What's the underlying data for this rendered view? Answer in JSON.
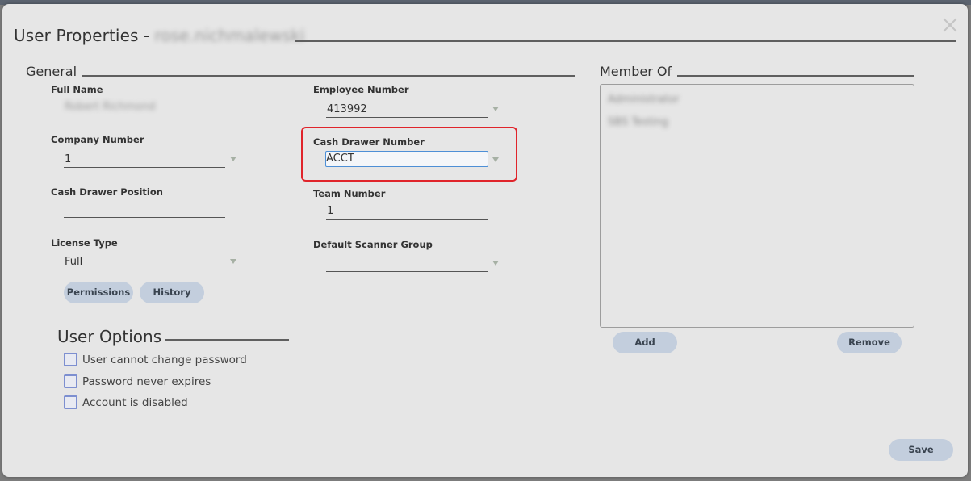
{
  "dialog": {
    "title": "User Properties -",
    "username": "rose.nichmalewski",
    "close_glyph": "×"
  },
  "general": {
    "title": "General",
    "full_name": {
      "label": "Full Name",
      "value": "Robert Richmond"
    },
    "company_number": {
      "label": "Company Number",
      "value": "1"
    },
    "cash_drawer_position": {
      "label": "Cash Drawer Position",
      "value": ""
    },
    "license_type": {
      "label": "License Type",
      "value": "Full"
    },
    "employee_number": {
      "label": "Employee Number",
      "value": "413992"
    },
    "cash_drawer_number": {
      "label": "Cash Drawer Number",
      "value": "ACCT"
    },
    "team_number": {
      "label": "Team Number",
      "value": "1"
    },
    "default_scanner_group": {
      "label": "Default Scanner Group",
      "value": ""
    },
    "permissions_button": "Permissions",
    "history_button": "History"
  },
  "user_options": {
    "title": "User Options",
    "options": [
      {
        "label": "User cannot change password",
        "checked": false
      },
      {
        "label": "Password never expires",
        "checked": false
      },
      {
        "label": "Account is disabled",
        "checked": false
      }
    ]
  },
  "member_of": {
    "title": "Member Of",
    "items": [
      "Administrator",
      "SBS Testing"
    ],
    "add_button": "Add",
    "remove_button": "Remove"
  },
  "footer": {
    "save_button": "Save"
  },
  "colors": {
    "highlight": "#e0242b",
    "button_bg": "#c3cedd",
    "checkbox_border": "#7d8fd0",
    "focus_border": "#4d8fd6",
    "dialog_bg": "#e6e6e6"
  }
}
